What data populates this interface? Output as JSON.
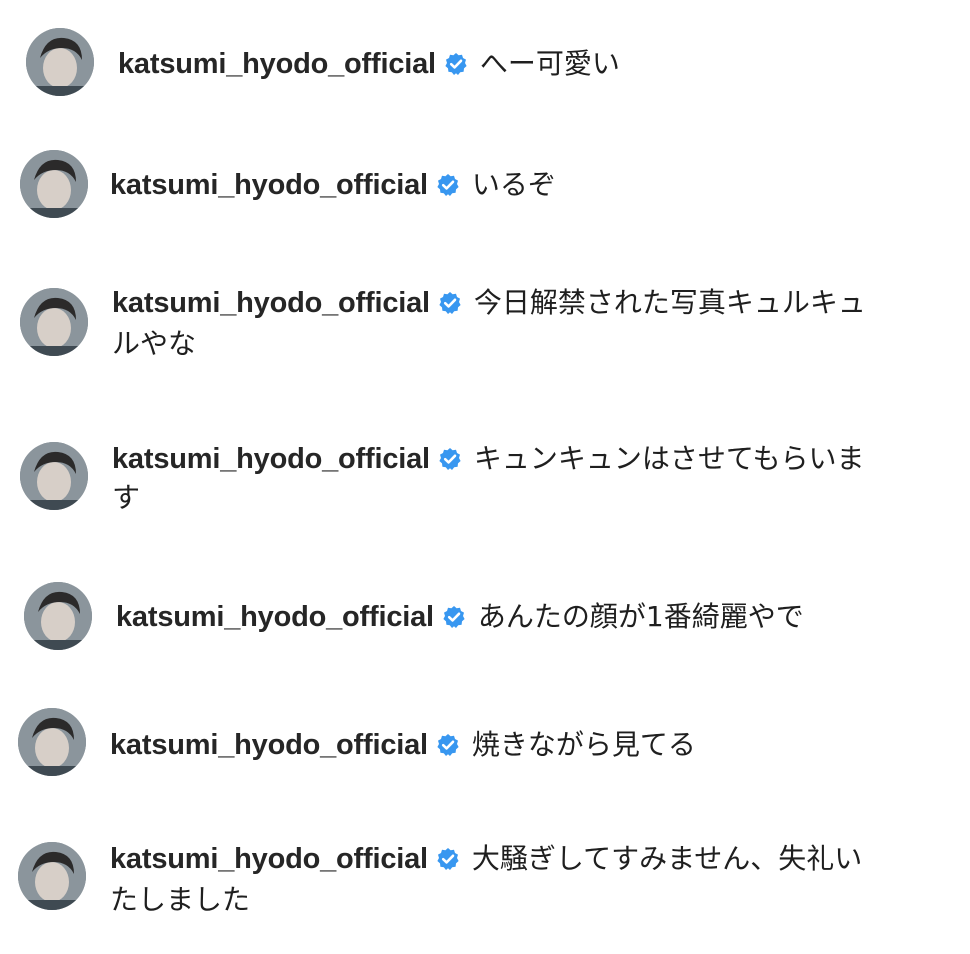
{
  "comments": [
    {
      "username": "katsumi_hyodo_official",
      "text": "へー可愛い",
      "text_cont": "",
      "verified_icon": "verified-badge-icon",
      "avatar_icon": "profile-photo-avatar"
    },
    {
      "username": "katsumi_hyodo_official",
      "text": "いるぞ",
      "text_cont": "",
      "verified_icon": "verified-badge-icon",
      "avatar_icon": "profile-photo-avatar"
    },
    {
      "username": "katsumi_hyodo_official",
      "text": "今日解禁された写真キュルキュ",
      "text_cont": "ルやな",
      "verified_icon": "verified-badge-icon",
      "avatar_icon": "profile-photo-avatar"
    },
    {
      "username": "katsumi_hyodo_official",
      "text": "キュンキュンはさせてもらいま",
      "text_cont": "す",
      "verified_icon": "verified-badge-icon",
      "avatar_icon": "profile-photo-avatar"
    },
    {
      "username": "katsumi_hyodo_official",
      "text": "あんたの顔が1番綺麗やで",
      "text_cont": "",
      "verified_icon": "verified-badge-icon",
      "avatar_icon": "profile-photo-avatar"
    },
    {
      "username": "katsumi_hyodo_official",
      "text": "焼きながら見てる",
      "text_cont": "",
      "verified_icon": "verified-badge-icon",
      "avatar_icon": "profile-photo-avatar"
    },
    {
      "username": "katsumi_hyodo_official",
      "text": "大騒ぎしてすみません、失礼い",
      "text_cont": "たしました",
      "verified_icon": "verified-badge-icon",
      "avatar_icon": "profile-photo-avatar"
    }
  ],
  "colors": {
    "verified_blue": "#3897f0",
    "username": "#262626",
    "text": "#1f1f1f",
    "background": "#ffffff"
  }
}
